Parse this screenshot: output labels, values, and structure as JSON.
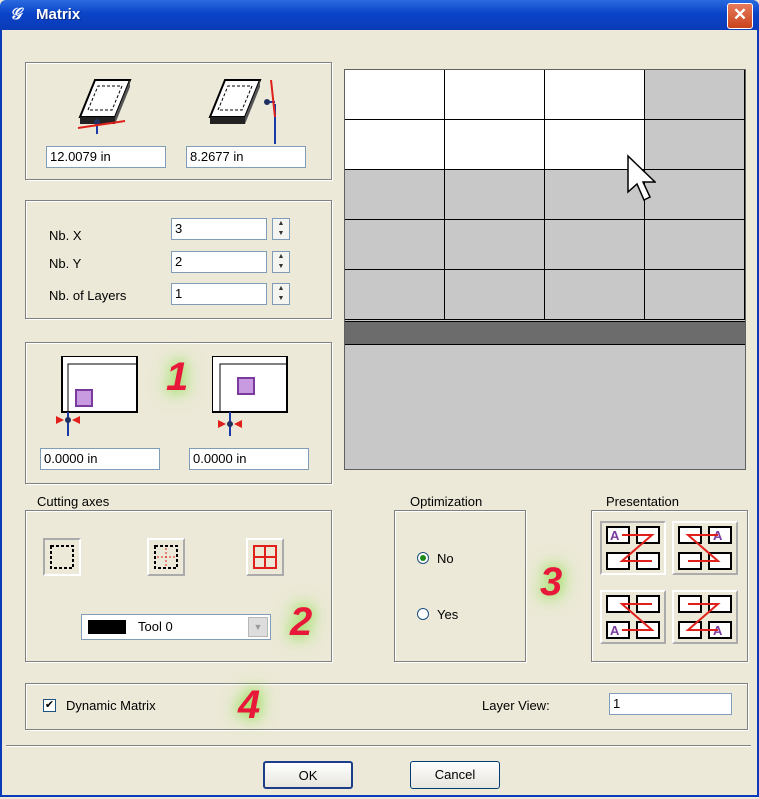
{
  "window": {
    "title": "Matrix",
    "close_label": "✕"
  },
  "dimensions": {
    "width_value": "12.0079 in",
    "height_value": "8.2677 in"
  },
  "counts": {
    "nb_x_label": "Nb. X",
    "nb_x_value": "3",
    "nb_y_label": "Nb. Y",
    "nb_y_value": "2",
    "layers_label": "Nb. of Layers",
    "layers_value": "1"
  },
  "offsets": {
    "left_value": "0.0000 in",
    "right_value": "0.0000 in"
  },
  "cutting_axes": {
    "label": "Cutting axes",
    "tool_value": "Tool 0"
  },
  "optimization": {
    "label": "Optimization",
    "no_label": "No",
    "yes_label": "Yes",
    "selected": "No"
  },
  "presentation": {
    "label": "Presentation"
  },
  "dynamic_matrix": {
    "label": "Dynamic Matrix",
    "checked": true
  },
  "layer_view": {
    "label": "Layer View:",
    "value": "1"
  },
  "buttons": {
    "ok_label": "OK",
    "cancel_label": "Cancel"
  },
  "annotations": {
    "n1": "1",
    "n2": "2",
    "n3": "3",
    "n4": "4"
  },
  "preview": {
    "columns": 4,
    "rows": 5,
    "white_cells": [
      [
        0,
        0
      ],
      [
        0,
        1
      ],
      [
        0,
        2
      ],
      [
        1,
        0
      ],
      [
        1,
        1
      ],
      [
        1,
        2
      ]
    ]
  },
  "colors": {
    "title_bar": "#0b44c8",
    "annotation": "#e8183a",
    "highlight": "#8fe04a"
  }
}
